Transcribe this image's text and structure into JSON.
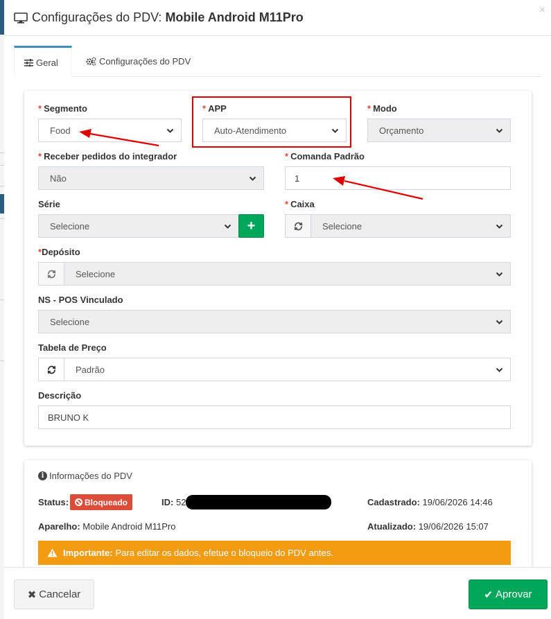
{
  "header": {
    "title_prefix": "Configurações do PDV:",
    "device_name": "Mobile Android M11Pro",
    "close_glyph": "×",
    "icon": "monitor-icon"
  },
  "tabs": [
    {
      "label": "Geral",
      "icon": "sliders-icon",
      "active": true
    },
    {
      "label": "Configurações do PDV",
      "icon": "cogs-icon",
      "active": false
    }
  ],
  "form": {
    "required_mark": "*",
    "segmento": {
      "label": "Segmento",
      "value": "Food",
      "required": true
    },
    "app": {
      "label": "APP",
      "value": "Auto-Atendimento",
      "required": true
    },
    "modo": {
      "label": "Modo",
      "value": "Orçamento",
      "required": true
    },
    "receber_pedidos": {
      "label": "Receber pedidos do integrador",
      "value": "Não",
      "required": true
    },
    "comanda_padrao": {
      "label": "Comanda Padrão",
      "value": "1",
      "required": true
    },
    "serie": {
      "label": "Série",
      "value": "Selecione",
      "add_glyph": "+"
    },
    "caixa": {
      "label": "Caixa",
      "value": "Selecione",
      "required": true
    },
    "deposito": {
      "label": "Depósito",
      "value": "Selecione",
      "required": true
    },
    "ns_pos": {
      "label": "NS - POS Vinculado",
      "value": "Selecione"
    },
    "tabela_preco": {
      "label": "Tabela de Preço",
      "value": "Padrão"
    },
    "descricao": {
      "label": "Descrição",
      "value": "BRUNO K"
    }
  },
  "info": {
    "title": "Informações do PDV",
    "status_label": "Status:",
    "status_value": "Bloqueado",
    "id_label": "ID:",
    "id_value": "52",
    "cadastrado_label": "Cadastrado:",
    "cadastrado_value": "19/06/2026 14:46",
    "aparelho_label": "Aparelho:",
    "aparelho_value": "Mobile Android M11Pro",
    "atualizado_label": "Atualizado:",
    "atualizado_value": "19/06/2026 15:07",
    "alert_strong": "Importante:",
    "alert_text": "Para editar os dados, efetue o bloqueio do PDV antes."
  },
  "footer": {
    "cancel_label": "Cancelar",
    "approve_label": "Aprovar"
  },
  "colors": {
    "primary": "#3c8dbc",
    "success": "#00a65a",
    "danger": "#dd4b39",
    "warning": "#f39c12",
    "annotation": "#e00000"
  }
}
